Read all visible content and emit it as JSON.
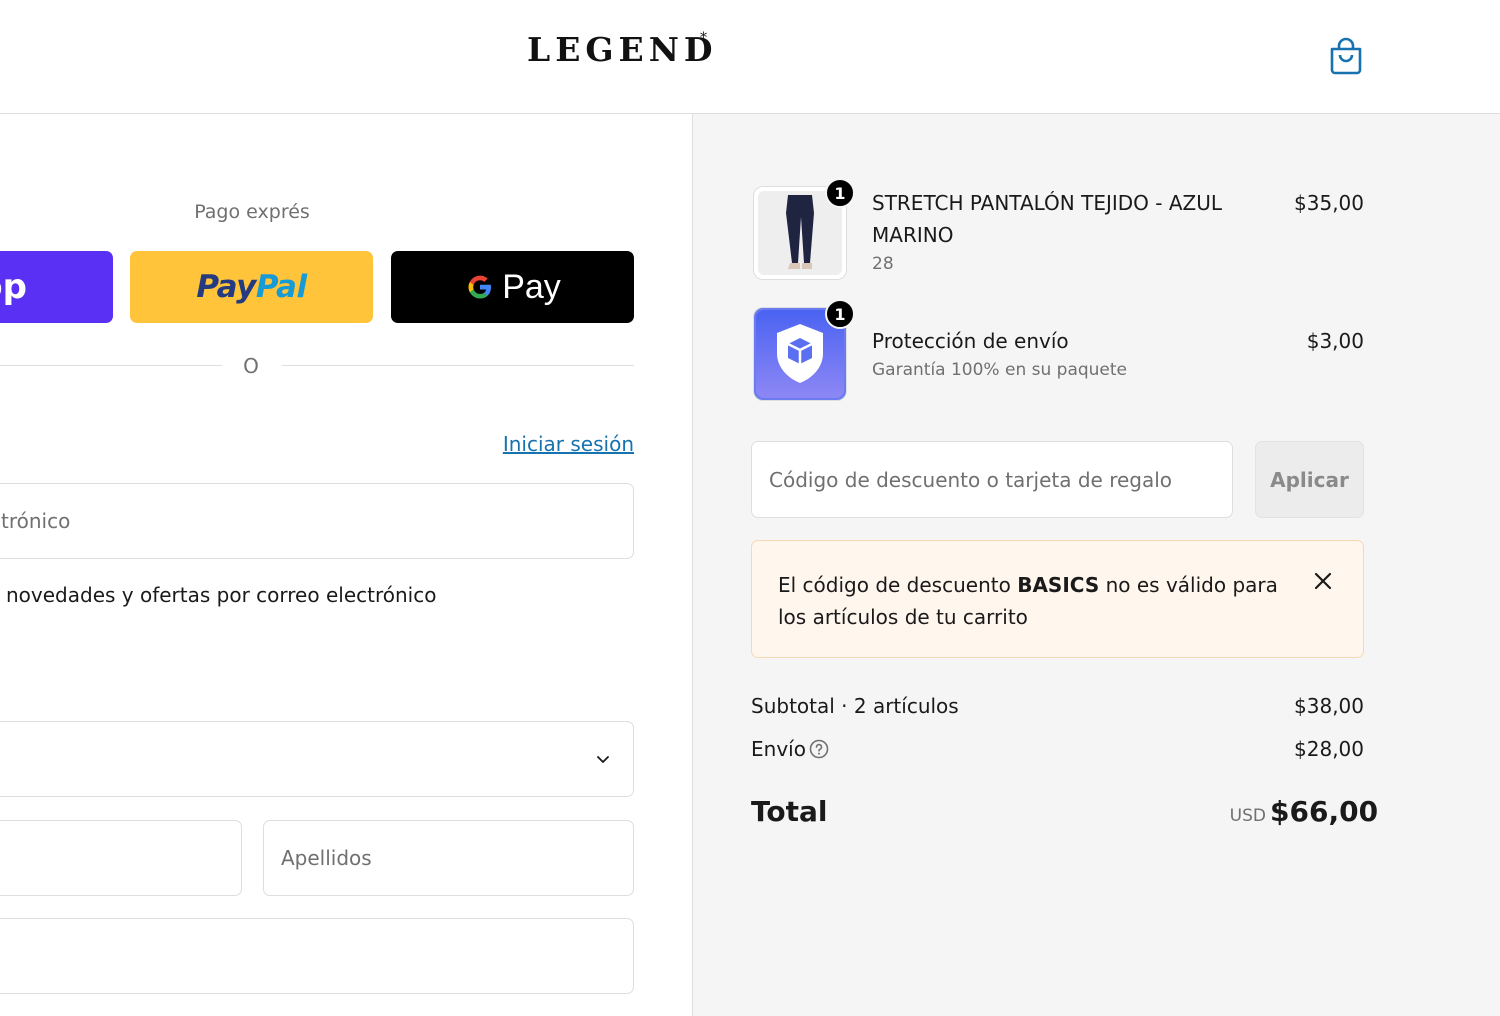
{
  "header": {
    "logo": "LEGEND",
    "logo_mark": "*",
    "cart_icon": "shopping-bag-icon"
  },
  "checkout": {
    "express_title": "Pago exprés",
    "shop_pay_label": "op",
    "paypal": {
      "part1": "Pay",
      "part2": "Pal"
    },
    "gpay_label": "Pay",
    "divider_text": "O",
    "login_link": "Iniciar sesión",
    "email_placeholder": "trónico",
    "newsletter_text": "novedades y ofertas por correo electrónico",
    "last_name_placeholder": "Apellidos"
  },
  "summary": {
    "items": [
      {
        "name": "STRETCH PANTALÓN TEJIDO - AZUL MARINO",
        "variant": "28",
        "price": "$35,00",
        "quantity": "1"
      },
      {
        "name": "Protección de envío",
        "variant": "Garantía 100% en su paquete",
        "price": "$3,00",
        "quantity": "1"
      }
    ],
    "discount_placeholder": "Código de descuento o tarjeta de regalo",
    "apply_label": "Aplicar",
    "error": {
      "prefix": "El código de descuento ",
      "code": "BASICS",
      "suffix": " no es válido para los artículos de tu carrito"
    },
    "subtotal_label": "Subtotal · 2 artículos",
    "subtotal_value": "$38,00",
    "shipping_label": "Envío",
    "shipping_value": "$28,00",
    "total_label": "Total",
    "total_currency": "USD",
    "total_value": "$66,00"
  },
  "colors": {
    "accent_link": "#1773b0",
    "shop_pay": "#5a31f4",
    "paypal_yellow": "#ffc439",
    "error_background": "#fff6ee"
  }
}
